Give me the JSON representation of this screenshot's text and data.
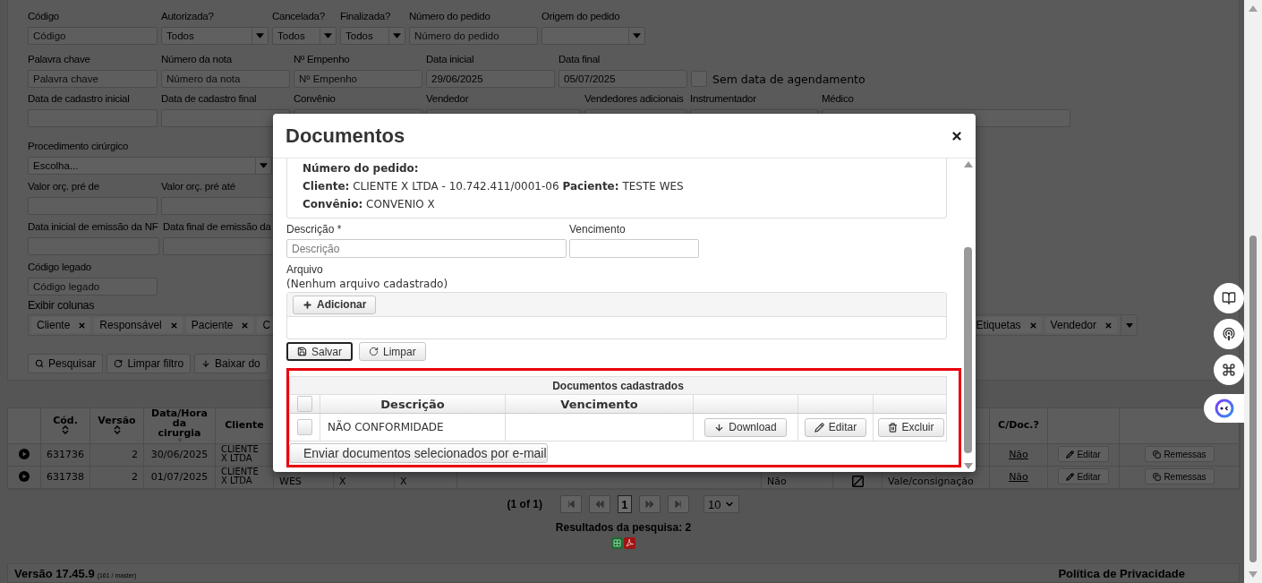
{
  "filters": {
    "rows": [
      {
        "fields": [
          {
            "label": "Código",
            "kind": "text",
            "placeholder": "Código"
          },
          {
            "label": "Autorizada?",
            "kind": "select",
            "value": "Todos"
          },
          {
            "label": "Cancelada?",
            "kind": "select",
            "value": "Todos"
          },
          {
            "label": "Finalizada?",
            "kind": "select",
            "value": "Todos"
          },
          {
            "label": "Número do pedido",
            "kind": "text",
            "placeholder": "Número do pedido"
          },
          {
            "label": "Origem do pedido",
            "kind": "select"
          }
        ]
      },
      {
        "fields": [
          {
            "label": "Palavra chave",
            "kind": "text",
            "placeholder": "Palavra chave"
          },
          {
            "label": "Número da nota",
            "kind": "text",
            "placeholder": "Número da nota"
          },
          {
            "label": "Nº Empenho",
            "kind": "text",
            "placeholder": "Nº Empenho"
          },
          {
            "label": "Data inicial",
            "kind": "text",
            "value": "29/06/2025"
          },
          {
            "label": "Data final",
            "kind": "text",
            "value": "05/07/2025"
          },
          {
            "label": "Sem data de agendamento",
            "kind": "checkbox",
            "checked": false
          }
        ]
      },
      {
        "fields": [
          {
            "label": "Data de cadastro inicial",
            "kind": "text"
          },
          {
            "label": "Data de cadastro final",
            "kind": "text"
          },
          {
            "label": "Convênio",
            "kind": "text"
          },
          {
            "label": "Vendedor",
            "kind": "text"
          },
          {
            "label": "Vendedores adicionais",
            "kind": "text"
          },
          {
            "label": "Instrumentador",
            "kind": "text"
          },
          {
            "label": "Médico",
            "kind": "text"
          }
        ]
      }
    ],
    "side_rows": [
      {
        "fields": [
          {
            "label": "Procedimento cirúrgico",
            "kind": "select",
            "value": "Escolha..."
          }
        ]
      },
      {
        "fields": [
          {
            "label": "Valor orç. pré de",
            "kind": "text"
          },
          {
            "label": "Valor orç. pré até",
            "kind": "text"
          }
        ]
      },
      {
        "fields": [
          {
            "label": "Data inicial de emissão da NF",
            "kind": "text"
          },
          {
            "label": "Data final de emissão da",
            "kind": "text"
          }
        ]
      },
      {
        "fields": [
          {
            "label": "Código legado",
            "kind": "text",
            "placeholder": "Código legado"
          }
        ]
      }
    ],
    "columns": {
      "label": "Exibir colunas",
      "tags": [
        {
          "text": "Cliente",
          "removable": true
        },
        {
          "text": "Responsável",
          "removable": true
        },
        {
          "text": "Paciente",
          "removable": true
        },
        {
          "text": "C"
        }
      ],
      "tags_right": [
        {
          "text": "Etiquetas",
          "removable": true
        },
        {
          "text": "Vendedor",
          "removable": true
        }
      ]
    },
    "actions": [
      {
        "kind": "search",
        "label": "Pesquisar"
      },
      {
        "kind": "reset",
        "label": "Limpar filtro"
      },
      {
        "kind": "download",
        "label": "Baixar do"
      }
    ]
  },
  "table": {
    "columns": [
      {
        "kind": "blank"
      },
      {
        "kind": "header",
        "label": "Cód.",
        "sortable": true
      },
      {
        "kind": "header",
        "label": "Versão",
        "sortable": true
      },
      {
        "kind": "header",
        "label": "Data/Hora da cirurgia",
        "sortable": true
      },
      {
        "kind": "header",
        "label": "Cliente"
      },
      {
        "kind": "blank"
      },
      {
        "kind": "blank"
      },
      {
        "kind": "blank"
      },
      {
        "kind": "blank"
      },
      {
        "kind": "blank"
      },
      {
        "kind": "blank"
      },
      {
        "kind": "blank"
      },
      {
        "kind": "header",
        "label": "C/Doc.?"
      },
      {
        "kind": "blank"
      },
      {
        "kind": "blank"
      }
    ],
    "rows": [
      {
        "cells": [
          {
            "kind": "expand"
          },
          {
            "kind": "text",
            "text": "631736"
          },
          {
            "kind": "number",
            "text": "2"
          },
          {
            "kind": "text",
            "text": "30/06/2025"
          },
          {
            "kind": "small",
            "text": "CLIENTE X LTDA"
          },
          {
            "kind": "empty"
          },
          {
            "kind": "empty"
          },
          {
            "kind": "empty"
          },
          {
            "kind": "empty"
          },
          {
            "kind": "empty"
          },
          {
            "kind": "empty"
          },
          {
            "kind": "empty"
          },
          {
            "kind": "link",
            "text": "Não"
          },
          {
            "kind": "edit",
            "text": "Editar"
          },
          {
            "kind": "shipments",
            "text": "Remessas"
          }
        ]
      },
      {
        "cells": [
          {
            "kind": "expand"
          },
          {
            "kind": "text",
            "text": "631738"
          },
          {
            "kind": "number",
            "text": "2"
          },
          {
            "kind": "text",
            "text": "01/07/2025"
          },
          {
            "kind": "small",
            "text": "CLIENTE X LTDA"
          },
          {
            "kind": "tail",
            "text": "WES"
          },
          {
            "kind": "tail",
            "text": "X"
          },
          {
            "kind": "tail",
            "text": "X"
          },
          {
            "kind": "empty"
          },
          {
            "kind": "tail",
            "text": "Não"
          },
          {
            "kind": "icon"
          },
          {
            "kind": "tail",
            "text": "Vale/consignação"
          },
          {
            "kind": "link",
            "text": "Não"
          },
          {
            "kind": "edit",
            "text": "Editar"
          },
          {
            "kind": "shipments",
            "text": "Remessas"
          }
        ]
      }
    ]
  },
  "pagination": {
    "summary": "(1 of 1)",
    "pages": [
      {
        "label": "1",
        "selected": true
      }
    ],
    "page_size": "10"
  },
  "results": "Resultados da pesquisa: 2",
  "footer": {
    "version": "Versão 17.45.9",
    "build": "(161 / master)",
    "privacy": "Política de Privacidade"
  },
  "modal": {
    "title": "Documentos",
    "info": [
      {
        "pairs": [
          {
            "label": "Número do pedido:"
          }
        ]
      },
      {
        "pairs": [
          {
            "label": "Cliente:",
            "value": "CLIENTE X LTDA - 10.742.411/0001-06"
          },
          {
            "label": "Paciente:",
            "value": "TESTE WES"
          }
        ]
      },
      {
        "pairs": [
          {
            "label": "Convênio:",
            "value": "CONVENIO X"
          }
        ]
      }
    ],
    "form": {
      "description": {
        "label": "Descrição *",
        "placeholder": "Descrição"
      },
      "due": {
        "label": "Vencimento"
      },
      "file_label": "Arquivo",
      "file_status": "(Nenhum arquivo cadastrado)",
      "add_button": "Adicionar",
      "save_button": {
        "label": "Salvar",
        "focused": true
      },
      "clear_button": "Limpar"
    },
    "documents": {
      "title": "Documentos cadastrados",
      "select_all": {
        "checked": false
      },
      "columns": [
        {
          "label": "Descrição"
        },
        {
          "label": "Vencimento"
        }
      ],
      "rows": [
        {
          "checked": false,
          "description": "NÃO CONFORMIDADE",
          "actions": [
            {
              "kind": "download",
              "label": "Download"
            },
            {
              "kind": "edit",
              "label": "Editar"
            },
            {
              "kind": "delete",
              "label": "Excluir"
            }
          ]
        }
      ],
      "email_button": "Enviar documentos selecionados por e-mail"
    }
  }
}
